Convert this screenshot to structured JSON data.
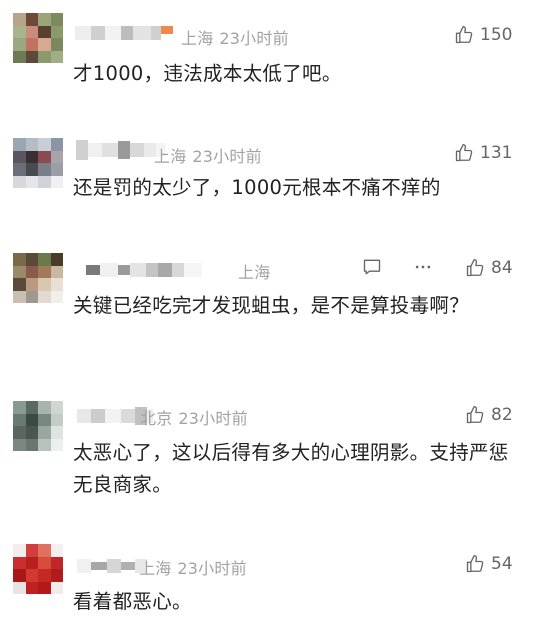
{
  "comments": [
    {
      "location": "上海",
      "time": "23小时前",
      "likes": "150",
      "text": "才1000，违法成本太低了吧。"
    },
    {
      "location": "上海",
      "time": "23小时前",
      "likes": "131",
      "text": "还是罚的太少了，1000元根本不痛不痒的"
    },
    {
      "location": "上海",
      "time": "",
      "likes": "84",
      "text": "关键已经吃完才发现蛆虫，是不是算投毒啊？"
    },
    {
      "location": "北京",
      "time": "23小时前",
      "likes": "82",
      "text": "太恶心了，这以后得有多大的心理阴影。支持严惩无良商家。"
    },
    {
      "location": "上海",
      "time": "23小时前",
      "likes": "54",
      "text": "看着都恶心。"
    }
  ],
  "icons": {
    "like": "thumbs-up-icon",
    "reply": "comment-icon",
    "more": "more-dots-icon"
  },
  "colors": {
    "meta": "#a3a3a3",
    "text": "#222222",
    "icon": "#666666"
  }
}
